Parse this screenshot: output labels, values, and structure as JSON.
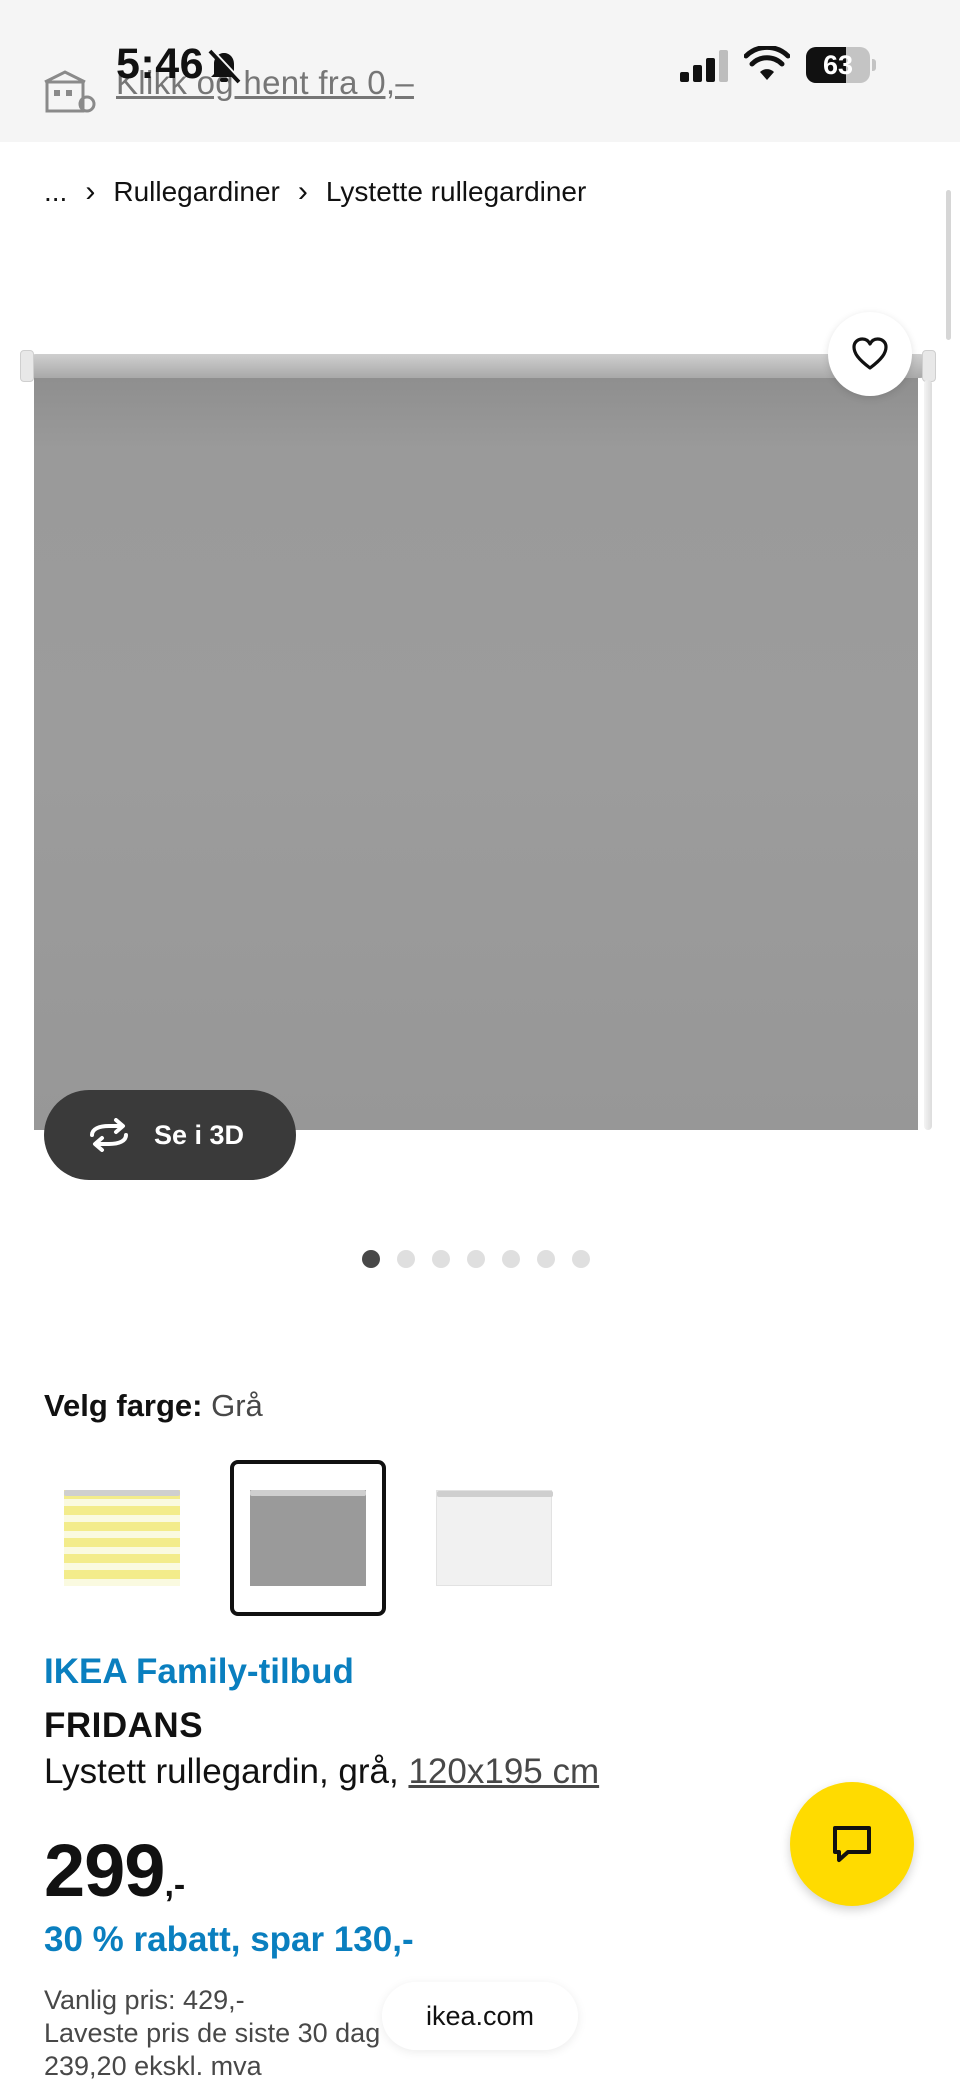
{
  "status_bar": {
    "time": "5:46",
    "battery": "63",
    "battery_level": 0.63
  },
  "store_banner": {
    "link_text": "Klikk og hent fra 0,–"
  },
  "breadcrumb": {
    "ellipsis": "...",
    "items": [
      "Rullegardiner",
      "Lystette rullegardiner"
    ]
  },
  "gallery": {
    "view_3d_label": "Se i 3D",
    "image_count": 7,
    "active_index": 0
  },
  "color_selector": {
    "label": "Velg farge:",
    "selected_value": "Grå",
    "swatches": [
      {
        "color": "yellow",
        "selected": false
      },
      {
        "color": "grey",
        "selected": true
      },
      {
        "color": "white",
        "selected": false
      }
    ]
  },
  "product": {
    "offer_label": "IKEA Family-tilbud",
    "name": "FRIDANS",
    "description": "Lystett rullegardin, grå,",
    "size": "120x195 cm",
    "price_main": "299",
    "price_suffix": ",-",
    "discount": "30 % rabatt, spar 130,-",
    "regular_price": "Vanlig pris: 429,-",
    "lowest_price_line": "Laveste pris de siste 30 dag",
    "excl_vat": "239,20 ekskl. mva"
  },
  "browser": {
    "url": "ikea.com"
  },
  "colors": {
    "ikea_blue": "#0a7fbf",
    "chat_yellow": "#ffdb00",
    "view3d_bg": "#3a3a3a"
  }
}
